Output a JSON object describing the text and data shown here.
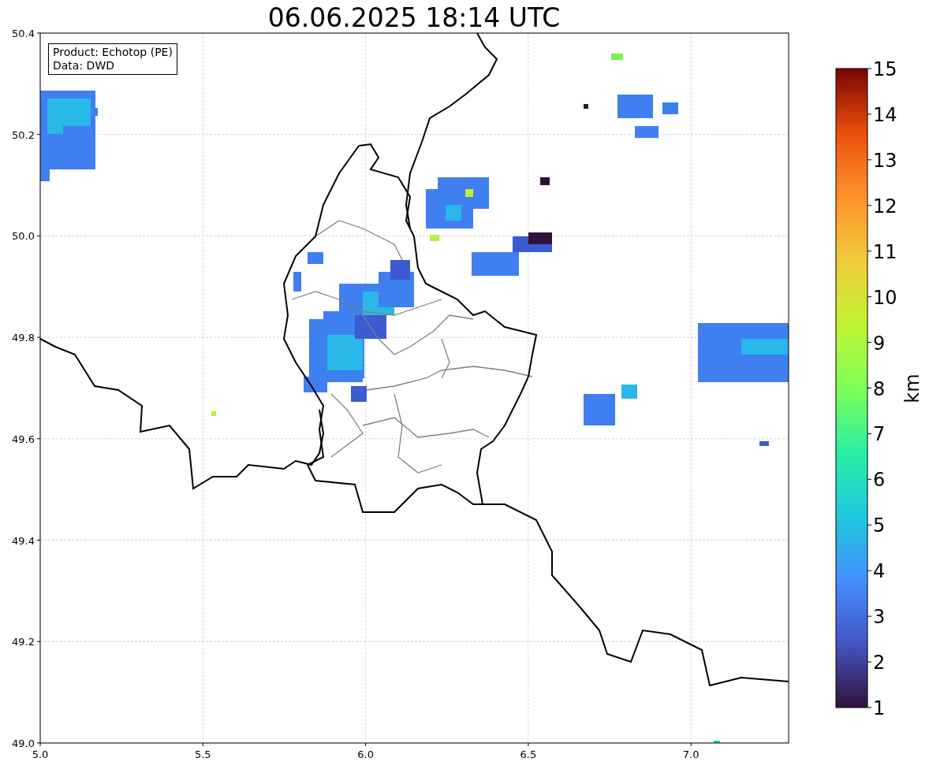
{
  "title": "06.06.2025 18:14 UTC",
  "legend": [
    "Product: Echotop (PE)",
    "Data: DWD"
  ],
  "x_ticks": [
    "5.0",
    "5.5",
    "6.0",
    "6.5",
    "7.0"
  ],
  "y_ticks": [
    "50.4",
    "50.2",
    "50.0",
    "49.8",
    "49.6",
    "49.4",
    "49.2",
    "49.0"
  ],
  "colorbar": {
    "label": "km",
    "ticks": [
      "15",
      "14",
      "13",
      "12",
      "11",
      "10",
      "9",
      "8",
      "7",
      "6",
      "5",
      "4",
      "3",
      "2",
      "1"
    ]
  }
}
